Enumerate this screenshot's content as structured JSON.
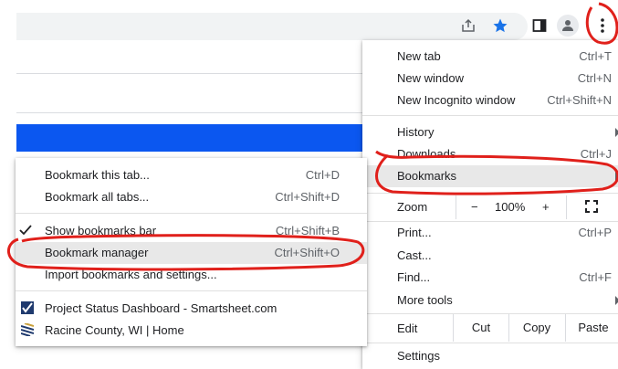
{
  "menu": {
    "new_tab": {
      "label": "New tab",
      "shortcut": "Ctrl+T"
    },
    "new_window": {
      "label": "New window",
      "shortcut": "Ctrl+N"
    },
    "new_incognito": {
      "label": "New Incognito window",
      "shortcut": "Ctrl+Shift+N"
    },
    "history": {
      "label": "History"
    },
    "downloads": {
      "label": "Downloads",
      "shortcut": "Ctrl+J"
    },
    "bookmarks": {
      "label": "Bookmarks"
    },
    "zoom": {
      "label": "Zoom",
      "minus": "−",
      "level": "100%",
      "plus": "+"
    },
    "print": {
      "label": "Print...",
      "shortcut": "Ctrl+P"
    },
    "cast": {
      "label": "Cast..."
    },
    "find": {
      "label": "Find...",
      "shortcut": "Ctrl+F"
    },
    "more_tools": {
      "label": "More tools"
    },
    "edit": {
      "label": "Edit",
      "cut": "Cut",
      "copy": "Copy",
      "paste": "Paste"
    },
    "settings": {
      "label": "Settings"
    }
  },
  "bookmarks_submenu": {
    "bookmark_tab": {
      "label": "Bookmark this tab...",
      "shortcut": "Ctrl+D"
    },
    "bookmark_all": {
      "label": "Bookmark all tabs...",
      "shortcut": "Ctrl+Shift+D"
    },
    "show_bar": {
      "label": "Show bookmarks bar",
      "shortcut": "Ctrl+Shift+B"
    },
    "manager": {
      "label": "Bookmark manager",
      "shortcut": "Ctrl+Shift+O"
    },
    "import": {
      "label": "Import bookmarks and settings..."
    },
    "items": [
      {
        "label": "Project Status Dashboard - Smartsheet.com"
      },
      {
        "label": "Racine County, WI | Home"
      }
    ]
  },
  "colors": {
    "accent": "#1a73e8",
    "highlight": "#e8e8e8",
    "annotation": "#e0201b",
    "bluebar": "#0b57f0"
  },
  "icons": [
    "share-icon",
    "star-icon",
    "side-panel-icon",
    "profile-icon",
    "more-vert-icon",
    "fullscreen-icon",
    "check-icon",
    "chevron-right-icon"
  ]
}
